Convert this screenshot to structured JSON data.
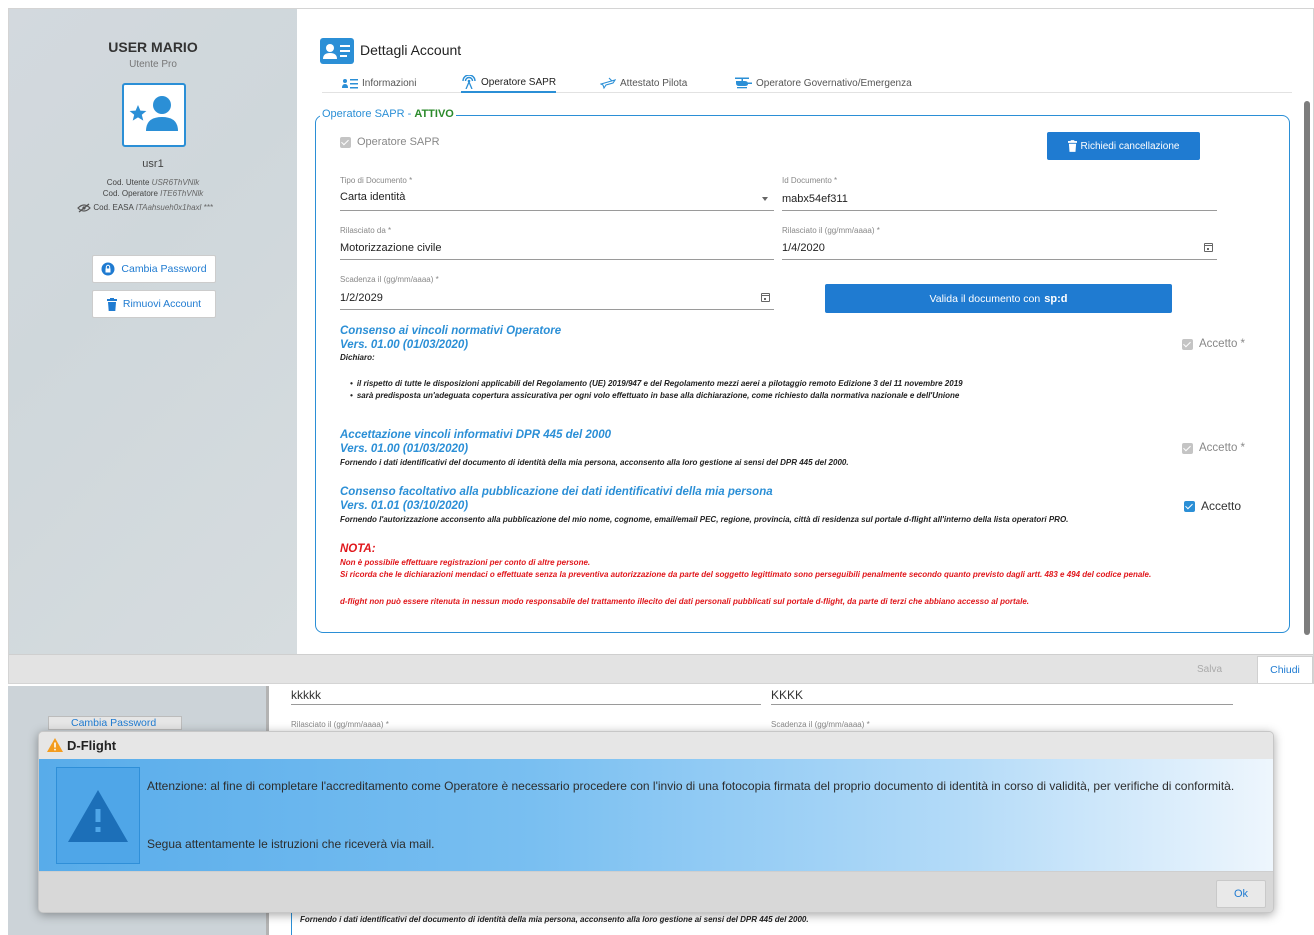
{
  "sidebar": {
    "user_name": "USER MARIO",
    "user_plan": "Utente Pro",
    "username": "usr1",
    "cod_utente_label": "Cod. Utente",
    "cod_utente_value": "USR6ThVNlk",
    "cod_operatore_label": "Cod. Operatore",
    "cod_operatore_value": "ITE6ThVNlk",
    "cod_easa_label": "Cod. EASA",
    "cod_easa_value": "ITAahsueh0x1haxl ***",
    "cambia_password": "Cambia Password",
    "rimuovi_account": "Rimuovi Account"
  },
  "header": {
    "title": "Dettagli Account"
  },
  "tabs": [
    {
      "label": "Informazioni"
    },
    {
      "label": "Operatore SAPR"
    },
    {
      "label": "Attestato Pilota"
    },
    {
      "label": "Operatore Governativo/Emergenza"
    }
  ],
  "section": {
    "legend_prefix": "Operatore SAPR - ",
    "legend_status": "ATTIVO",
    "checkbox_operatore": "Operatore SAPR",
    "richiedi_cancellazione": "Richiedi cancellazione"
  },
  "form": {
    "tipo_documento_label": "Tipo di Documento *",
    "tipo_documento_value": "Carta identità",
    "id_documento_label": "Id Documento *",
    "id_documento_value": "mabx54ef311",
    "rilasciato_da_label": "Rilasciato da *",
    "rilasciato_da_value": "Motorizzazione civile",
    "rilasciato_il_label": "Rilasciato il (gg/mm/aaaa) *",
    "rilasciato_il_value": "1/4/2020",
    "scadenza_label": "Scadenza il (gg/mm/aaaa) *",
    "scadenza_value": "1/2/2029",
    "valida_prefix": "Valida il documento con",
    "valida_brand": "sp:d"
  },
  "consents": {
    "c1_title": "Consenso ai vincoli normativi Operatore",
    "c1_version": "Vers. 01.00 (01/03/2020)",
    "c1_dichiaro": "Dichiaro:",
    "c1_bullet1": "il rispetto di tutte le disposizioni applicabili del Regolamento (UE) 2019/947 e del Regolamento mezzi aerei a pilotaggio remoto Edizione 3 del 11 novembre 2019",
    "c1_bullet2": "sarà predisposta un'adeguata copertura assicurativa per ogni volo effettuato in base alla dichiarazione, come richiesto dalla normativa nazionale e dell'Unione",
    "c1_accept": "Accetto *",
    "c2_title": "Accettazione vincoli informativi DPR 445 del 2000",
    "c2_version": "Vers. 01.00 (01/03/2020)",
    "c2_text": "Fornendo i dati identificativi del documento di identità della mia persona, acconsento alla loro gestione ai sensi del DPR 445 del 2000.",
    "c2_accept": "Accetto *",
    "c3_title": "Consenso facoltativo alla pubblicazione dei dati identificativi della mia persona",
    "c3_version": "Vers. 01.01 (03/10/2020)",
    "c3_text": "Fornendo l'autorizzazione acconsento alla pubblicazione del mio nome, cognome, email/email PEC, regione, provincia, città di residenza sul portale d-flight all'interno della lista operatori PRO.",
    "c3_accept": "Accetto"
  },
  "nota": {
    "title": "NOTA:",
    "line1": "Non è possibile effettuare registrazioni per conto di altre persone.",
    "line2": "Si ricorda che le dichiarazioni mendaci o effettuate senza la preventiva autorizzazione da parte del soggetto legittimato sono perseguibili penalmente secondo quanto previsto dagli artt. 483 e 494 del codice penale.",
    "line3": "d-flight non può essere ritenuta in nessun modo responsabile del trattamento illecito dei dati personali pubblicati sul portale d-flight, da parte di terzi che abbiano accesso al portale."
  },
  "footer": {
    "salva": "Salva",
    "chiudi": "Chiudi"
  },
  "background_window": {
    "field1_value": "kkkkk",
    "field2_value": "KKKK",
    "rilasciato_label": "Rilasciato il (gg/mm/aaaa) *",
    "scadenza_label": "Scadenza il (gg/mm/aaaa) *",
    "cambia_password": "Cambia Password",
    "text": "Fornendo i dati identificativi del documento di identità della mia persona, acconsento alla loro gestione ai sensi del DPR 445 del 2000."
  },
  "dialog": {
    "title": "D-Flight",
    "message1": "Attenzione: al fine di completare l'accreditamento come Operatore è necessario procedere con l'invio di una fotocopia firmata del proprio documento di identità in corso di validità, per verifiche di conformità.",
    "message2": "Segua attentamente le istruzioni che riceverà via mail.",
    "ok": "Ok"
  },
  "colors": {
    "accent": "#1f7bd1",
    "active_status": "#2a8a2a",
    "warning_text": "#e0161b"
  },
  "icons": [
    "account-card-icon",
    "info-list-icon",
    "antenna-icon",
    "plane-icon",
    "helicopter-icon",
    "trash-icon",
    "lock-icon",
    "eye-off-icon",
    "calendar-icon",
    "warning-icon",
    "user-star-icon"
  ]
}
